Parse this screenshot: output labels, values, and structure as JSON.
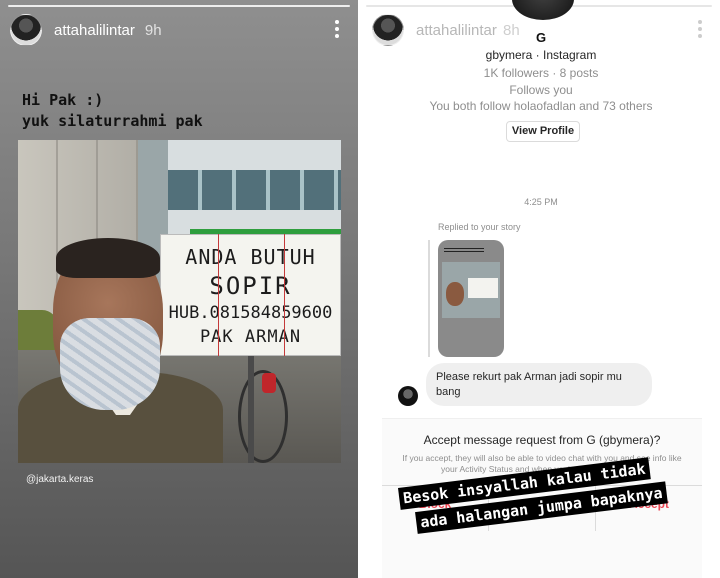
{
  "left_story": {
    "username": "attahalilintar",
    "time_ago": "9h",
    "text_line1": "Hi Pak :)",
    "text_line2": "yuk silaturrahmi pak",
    "sign": {
      "line1": "ANDA BUTUH",
      "line2": "SOPIR",
      "line3": "HUB.081584859600",
      "line4": "PAK ARMAN"
    },
    "source_tag": "@jakarta.keras"
  },
  "right_story": {
    "username": "attahalilintar",
    "time_ago": "8h",
    "profile": {
      "name": "G",
      "handle": "gbymera · Instagram",
      "stats": "1K followers · 8 posts",
      "follows_you": "Follows you",
      "mutual": "You both follow holaofadlan and 73 others",
      "view_profile": "View Profile"
    },
    "timestamp": "4:25 PM",
    "replied_label": "Replied to your story",
    "thumbnail_text": "Hi Pak :) yuk silaturrahmi pak",
    "message": "Please rekurt pak Arman jadi sopir mu bang",
    "request": {
      "title": "Accept message request from G (gbymera)?",
      "description": "If you accept, they will also be able to video chat with you and see info like your Activity Status and when you've seen messages.",
      "block": "Block",
      "delete": "Delete",
      "accept": "Accept"
    },
    "caption_line1": "Besok insyallah kalau tidak",
    "caption_line2": "ada halangan jumpa bapaknya"
  },
  "colors": {
    "accent_red": "#ed4956",
    "caption_bg": "#000000"
  }
}
